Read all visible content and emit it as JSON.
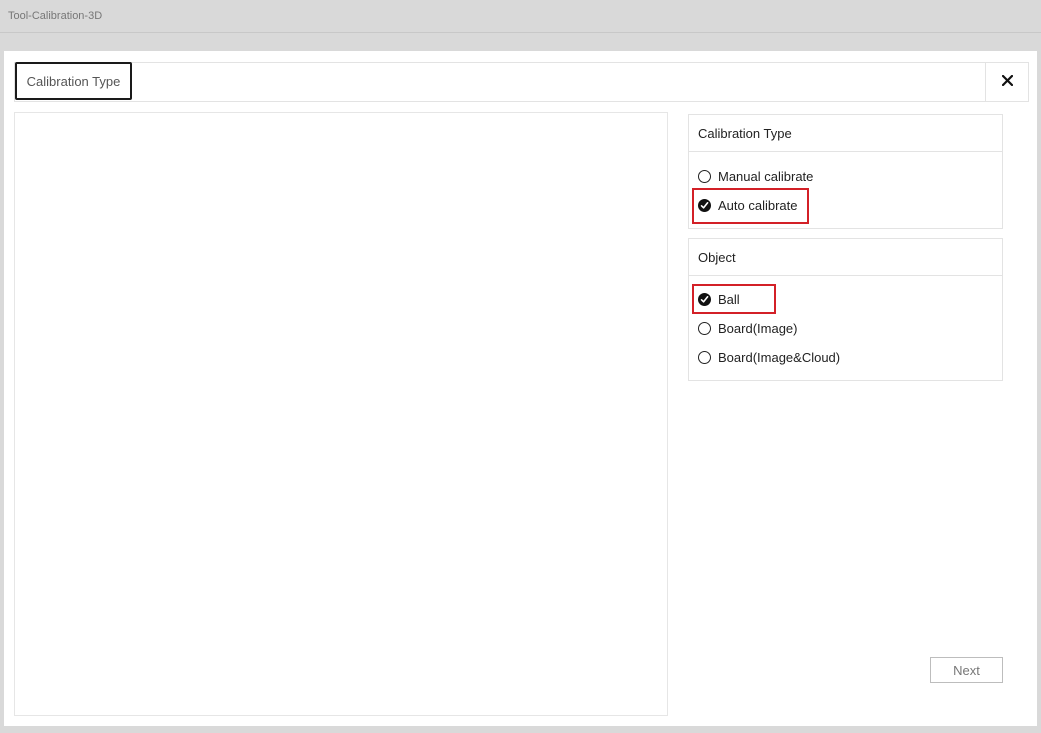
{
  "window": {
    "title": "Tool-Calibration-3D"
  },
  "tabs": [
    {
      "label": "Calibration Type",
      "active": true
    }
  ],
  "close_icon": "close-icon",
  "calibration_type": {
    "header": "Calibration Type",
    "options": [
      {
        "label": "Manual calibrate",
        "checked": false
      },
      {
        "label": "Auto calibrate",
        "checked": true
      }
    ]
  },
  "object": {
    "header": "Object",
    "options": [
      {
        "label": "Ball",
        "checked": true
      },
      {
        "label": "Board(Image)",
        "checked": false
      },
      {
        "label": "Board(Image&Cloud)",
        "checked": false
      }
    ]
  },
  "footer": {
    "next_label": "Next"
  },
  "colors": {
    "highlight": "#d32027",
    "tab_border": "#1a1a1a"
  }
}
